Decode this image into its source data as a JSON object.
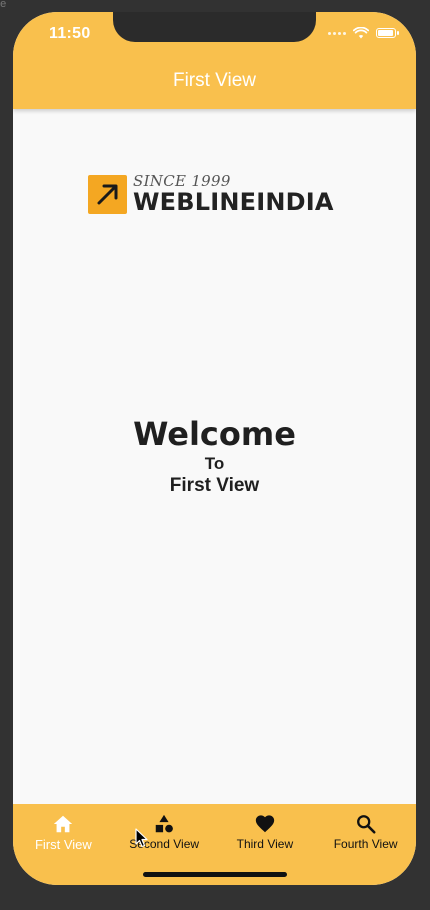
{
  "status_bar": {
    "time": "11:50",
    "icons": [
      "signal-dots-icon",
      "wifi-icon",
      "battery-icon"
    ],
    "battery_level": 1.0
  },
  "app_bar": {
    "title": "First View"
  },
  "logo": {
    "tagline": "SINCE 1999",
    "name": "WEBLINEINDIA",
    "mark_icon": "arrow-up-right-icon"
  },
  "main": {
    "heading": "Welcome",
    "line2": "To",
    "line3": "First View"
  },
  "tabs": [
    {
      "label": "First View",
      "icon": "home-icon",
      "active": true
    },
    {
      "label": "Second View",
      "icon": "shapes-icon",
      "active": false
    },
    {
      "label": "Third View",
      "icon": "heart-icon",
      "active": false
    },
    {
      "label": "Fourth View",
      "icon": "search-icon",
      "active": false
    }
  ],
  "bezel_label": "ee",
  "colors": {
    "accent": "#f9c04d",
    "logo_mark": "#f4a722",
    "background": "#f9f9f9",
    "bezel": "#323232",
    "active_tab_text": "#ffffff",
    "inactive_tab_text": "#111111"
  }
}
